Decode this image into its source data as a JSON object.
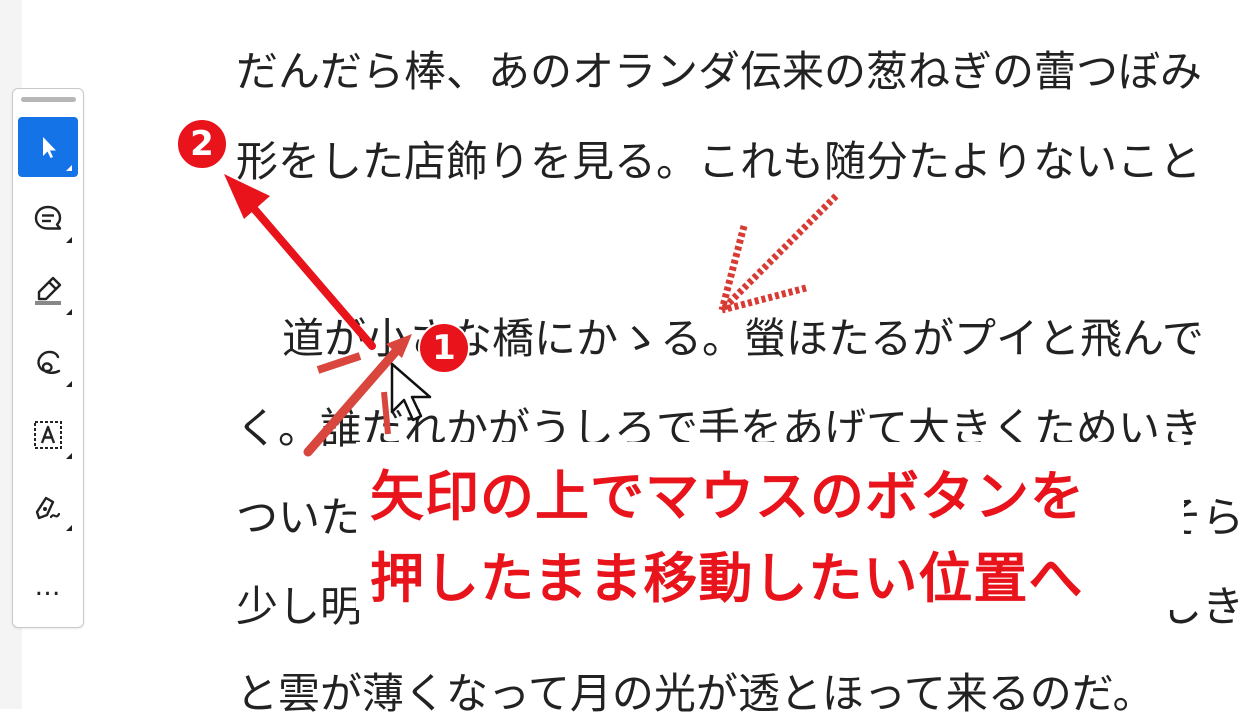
{
  "document": {
    "lines": [
      "だんだら棒、あのオランダ伝来の葱ねぎの蕾つぼみ",
      "形をした店飾りを見る。これも随分たよりないこと",
      "道が小さな橋にかゝる。螢ほたるがプイと飛んで",
      "く。誰だれかがうしろで手をあげて大きくためいき",
      "ついた",
      "そら",
      "少し明",
      "しき",
      "と雲が薄くなって月の光が透とほって来るのだ。"
    ]
  },
  "toolbar": {
    "tools": [
      {
        "name": "select-tool",
        "icon": "cursor-arrow-icon",
        "active": true
      },
      {
        "name": "comment-tool",
        "icon": "comment-bubble-icon",
        "active": false
      },
      {
        "name": "highlight-tool",
        "icon": "highlighter-pen-icon",
        "active": false
      },
      {
        "name": "draw-tool",
        "icon": "freehand-draw-icon",
        "active": false
      },
      {
        "name": "text-tool",
        "icon": "text-box-icon",
        "active": false
      },
      {
        "name": "sign-tool",
        "icon": "signature-pen-icon",
        "active": false
      }
    ],
    "more_label": "…",
    "text_tool_glyph": "A"
  },
  "annotation": {
    "callout_line1": "矢印の上でマウスのボタンを",
    "callout_line2": "押したまま移動したい位置へ",
    "badge1": "1",
    "badge2": "2",
    "color": "#e8131b"
  },
  "colors": {
    "accent": "#1473e6",
    "annotation_red": "#e8131b",
    "arrow_stroke_red": "#d83a34"
  }
}
